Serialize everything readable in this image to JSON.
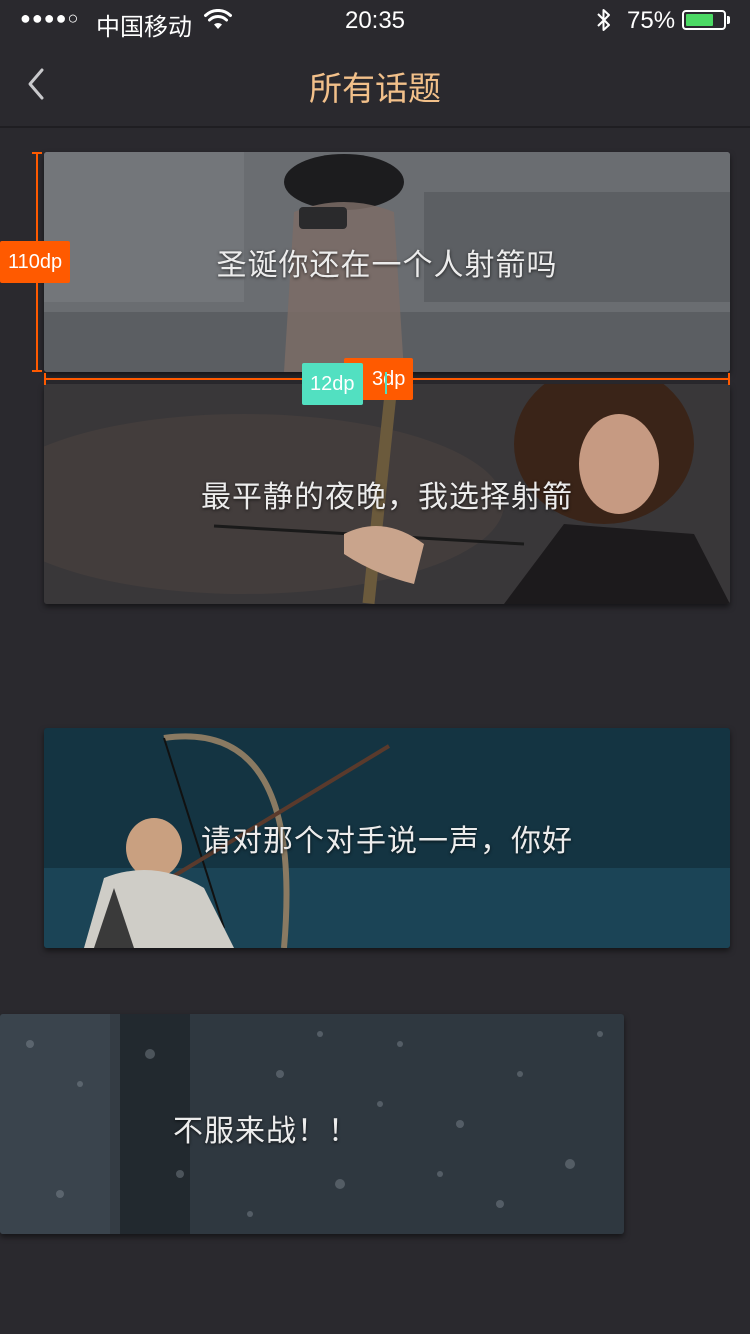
{
  "status_bar": {
    "signal": "●●●●○",
    "carrier": "中国移动",
    "time": "20:35",
    "battery_percent": "75%",
    "battery_level": 0.75,
    "icons": [
      "wifi-icon",
      "bluetooth-icon",
      "battery-icon"
    ]
  },
  "nav": {
    "title": "所有话题",
    "back_icon": "chevron-left-icon"
  },
  "topics": [
    {
      "title": "圣诞你还在一个人射箭吗"
    },
    {
      "title": "最平静的夜晚，我选择射箭"
    },
    {
      "title": "请对那个对手说一声，你好"
    },
    {
      "title": "不服来战！！"
    }
  ],
  "annotations": {
    "height_label": "110dp",
    "gap_label": "12dp",
    "width_label": "3dp"
  },
  "colors": {
    "background": "#2a292e",
    "title_accent": "#f2c08a",
    "annotation_orange": "#ff5a00",
    "annotation_green": "#52e0c1",
    "battery_green": "#4cd964"
  }
}
